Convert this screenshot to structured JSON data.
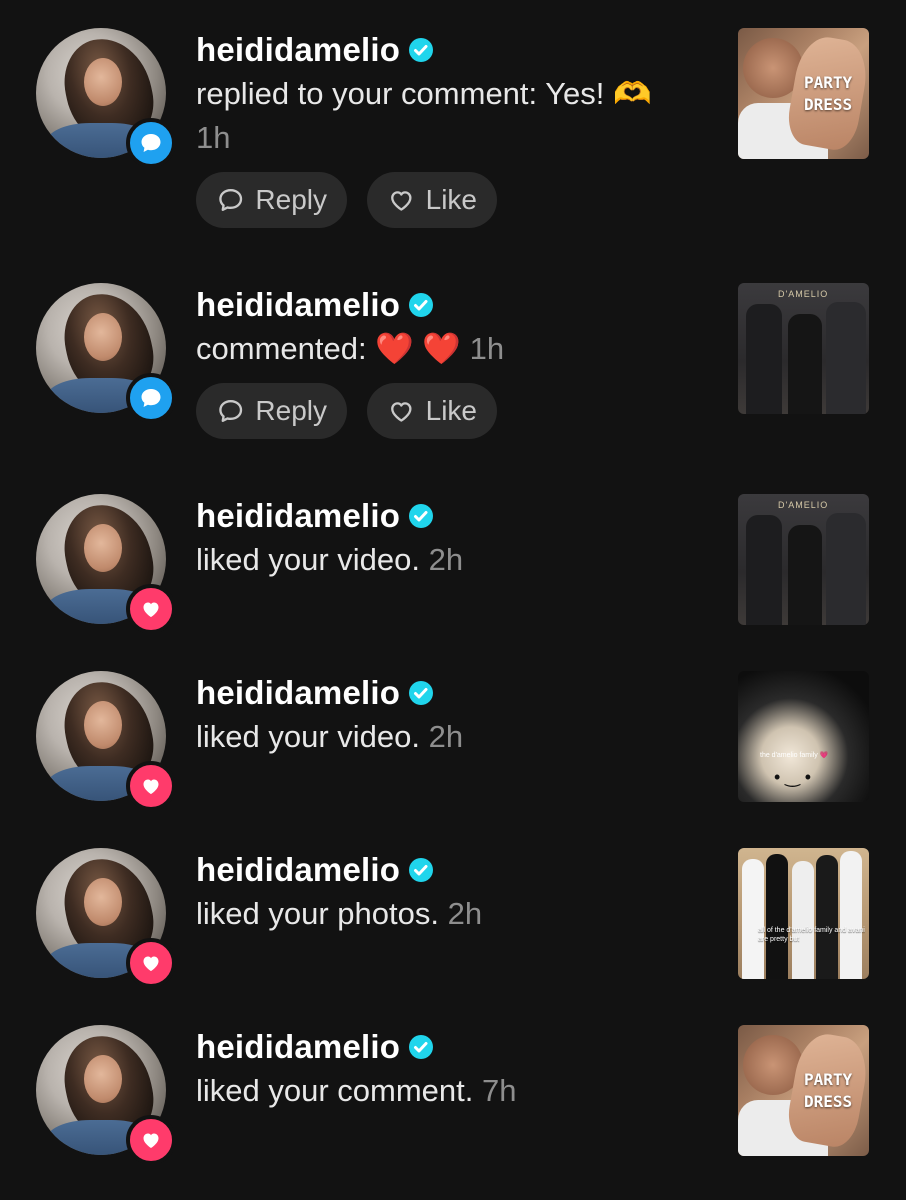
{
  "notifications": [
    {
      "username": "heididamelio",
      "message": "replied to your comment: Yes! 🫶",
      "time": "1h",
      "type": "comment",
      "badge_icon": "speech-bubble-icon",
      "has_actions": true,
      "reply_label": "Reply",
      "like_label": "Like",
      "thumbnail": "party-dress",
      "thumbnail_caption": "PARTY\nDRESS"
    },
    {
      "username": "heididamelio",
      "message": "commented: ❤️ ❤️",
      "time": "1h",
      "type": "comment",
      "badge_icon": "speech-bubble-icon",
      "has_actions": true,
      "reply_label": "Reply",
      "like_label": "Like",
      "thumbnail": "event",
      "thumbnail_caption": "D'AMELIO"
    },
    {
      "username": "heididamelio",
      "message": "liked your video.",
      "time": "2h",
      "type": "like",
      "badge_icon": "heart-icon",
      "has_actions": false,
      "thumbnail": "event",
      "thumbnail_caption": "D'AMELIO"
    },
    {
      "username": "heididamelio",
      "message": "liked your video.",
      "time": "2h",
      "type": "like",
      "badge_icon": "heart-icon",
      "has_actions": false,
      "thumbnail": "plush",
      "thumbnail_caption": "the d'amelio family 💗"
    },
    {
      "username": "heididamelio",
      "message": "liked your photos.",
      "time": "2h",
      "type": "like",
      "badge_icon": "heart-icon",
      "has_actions": false,
      "thumbnail": "group",
      "thumbnail_caption": "all of the d'amelio family and avani are pretty but"
    },
    {
      "username": "heididamelio",
      "message": "liked your comment.",
      "time": "7h",
      "type": "like",
      "badge_icon": "heart-icon",
      "has_actions": false,
      "thumbnail": "party-dress",
      "thumbnail_caption": "PARTY\nDRESS"
    }
  ],
  "colors": {
    "background": "#121212",
    "comment_badge": "#1fa1f0",
    "like_badge": "#ff3b6b",
    "verified": "#20d5ec",
    "secondary_text": "#8e8e8e",
    "pill_bg": "#2a2a2a"
  }
}
